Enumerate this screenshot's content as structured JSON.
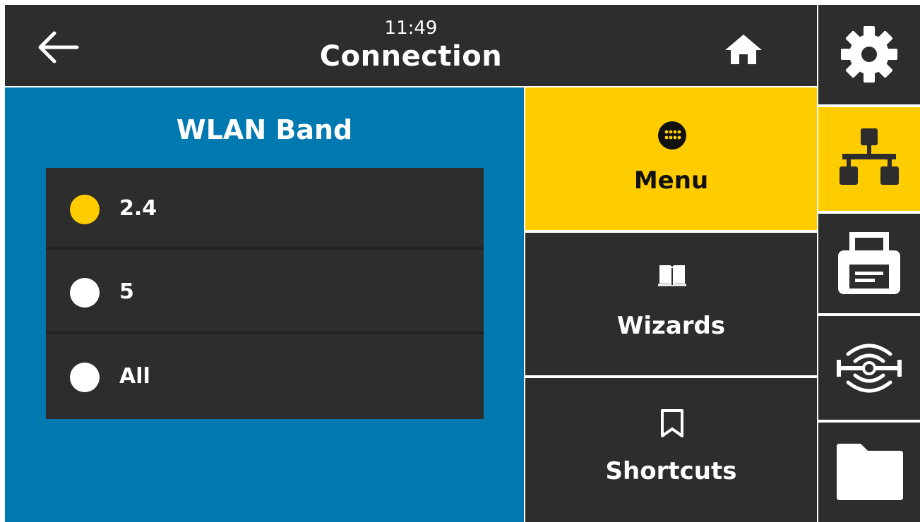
{
  "header": {
    "time": "11:49",
    "title": "Connection"
  },
  "panel": {
    "title": "WLAN Band",
    "options": [
      {
        "label": "2.4",
        "selected": true
      },
      {
        "label": "5",
        "selected": false
      },
      {
        "label": "All",
        "selected": false
      }
    ]
  },
  "nav": {
    "items": [
      {
        "label": "Menu",
        "icon": "menu-grid-icon",
        "active": true
      },
      {
        "label": "Wizards",
        "icon": "book-icon",
        "active": false
      },
      {
        "label": "Shortcuts",
        "icon": "bookmark-icon",
        "active": false
      }
    ]
  },
  "sidebar": {
    "items": [
      {
        "icon": "gear-icon",
        "active": false
      },
      {
        "icon": "network-icon",
        "active": true
      },
      {
        "icon": "printer-icon",
        "active": false
      },
      {
        "icon": "rfid-icon",
        "active": false
      },
      {
        "icon": "folder-icon",
        "active": false
      }
    ]
  },
  "colors": {
    "dark": "#2d2d2d",
    "accent": "#ffcc00",
    "panel_blue": "#0079b0",
    "text": "#ffffff"
  }
}
